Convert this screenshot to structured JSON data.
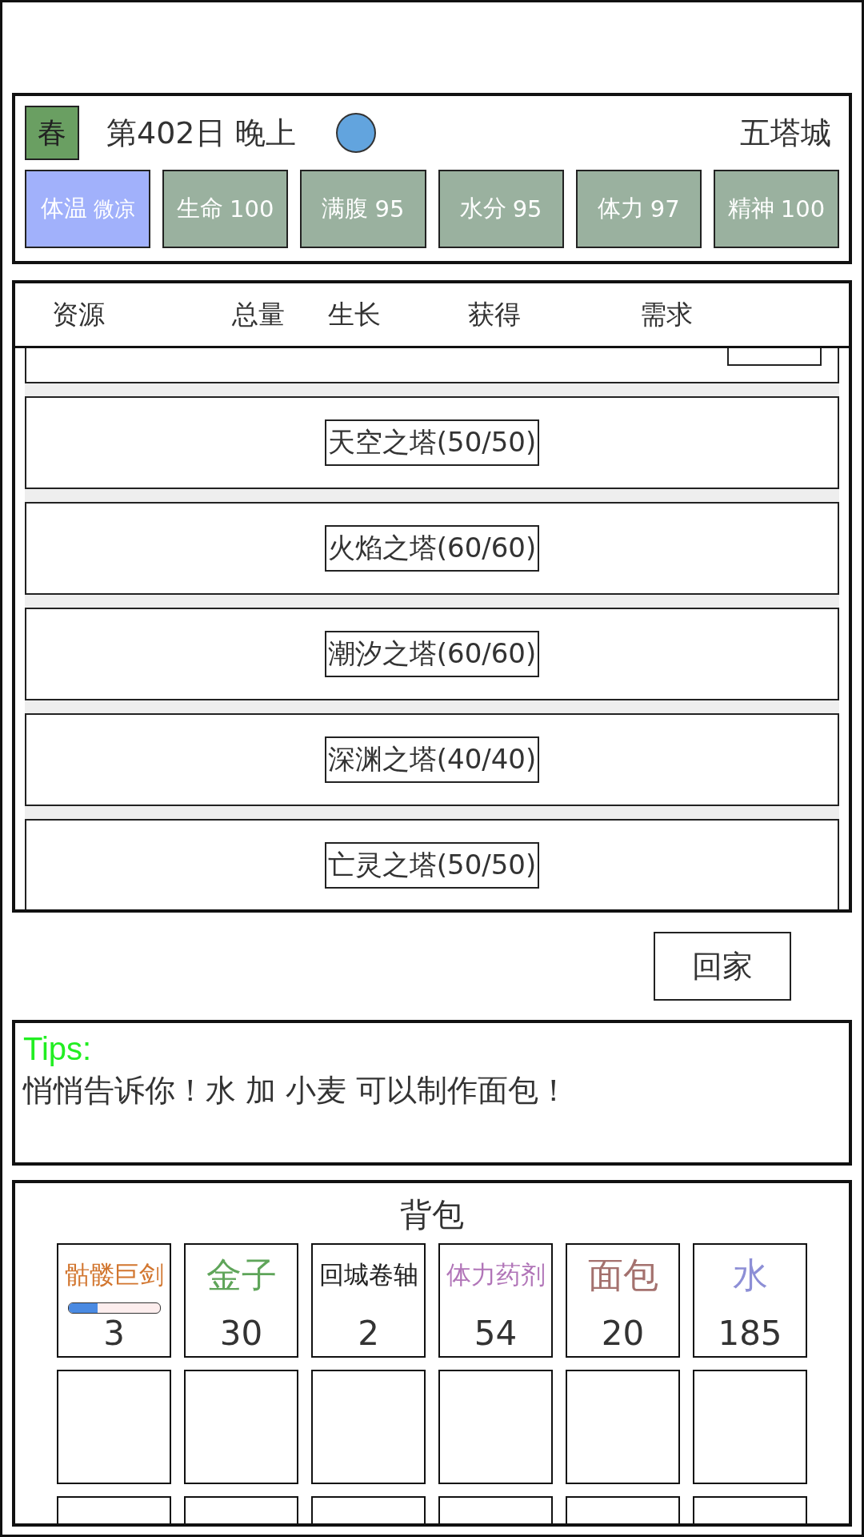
{
  "header": {
    "season": "春",
    "date_time": "第402日 晚上",
    "location": "五塔城"
  },
  "stats": [
    {
      "kind": "temperature",
      "label": "体温",
      "value": "微凉"
    },
    {
      "kind": "stat",
      "label": "生命",
      "value": "100"
    },
    {
      "kind": "stat",
      "label": "满腹",
      "value": "95"
    },
    {
      "kind": "stat",
      "label": "水分",
      "value": "95"
    },
    {
      "kind": "stat",
      "label": "体力",
      "value": "97"
    },
    {
      "kind": "stat",
      "label": "精神",
      "value": "100"
    }
  ],
  "table": {
    "columns": [
      "资源",
      "总量",
      "生长",
      "获得",
      "需求"
    ],
    "rows": [
      {
        "label": "天空之塔(50/50)"
      },
      {
        "label": "火焰之塔(60/60)"
      },
      {
        "label": "潮汐之塔(60/60)"
      },
      {
        "label": "深渊之塔(40/40)"
      },
      {
        "label": "亡灵之塔(50/50)"
      }
    ]
  },
  "home_button": "回家",
  "tips": {
    "title": "Tips:",
    "text": "悄悄告诉你！水 加 小麦 可以制作面包！"
  },
  "backpack": {
    "title": "背包",
    "items": [
      {
        "name": "骷髅巨剑",
        "count": "3",
        "color": "#d2762f",
        "level": 0.32
      },
      {
        "name": "金子",
        "count": "30",
        "color": "#5fa55a"
      },
      {
        "name": "回城卷轴",
        "count": "2",
        "color": "#222222"
      },
      {
        "name": "体力药剂",
        "count": "54",
        "color": "#b175b8"
      },
      {
        "name": "面包",
        "count": "20",
        "color": "#a4716e"
      },
      {
        "name": "水",
        "count": "185",
        "color": "#8d8fd6"
      }
    ]
  }
}
